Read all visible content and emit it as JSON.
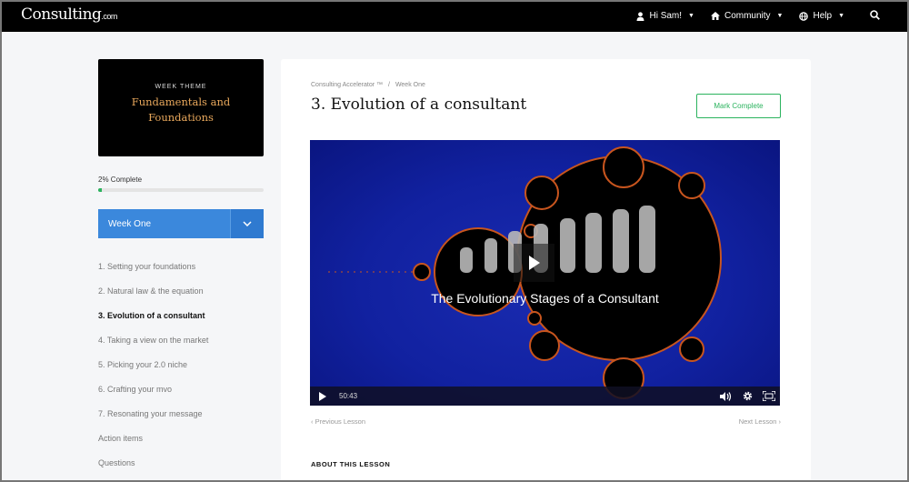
{
  "brand": {
    "logo_main": "Consulting",
    "logo_sub": ".com"
  },
  "nav": {
    "greeting": "Hi Sam!",
    "community": "Community",
    "help": "Help",
    "icons": [
      "user-icon",
      "home-icon",
      "globe-icon",
      "search-icon"
    ]
  },
  "sidebar": {
    "theme_kicker": "WEEK THEME",
    "theme_title": "Fundamentals and Foundations",
    "progress_label": "2% Complete",
    "progress_fraction": 0.02,
    "week_label": "Week One",
    "lessons": [
      "1. Setting your foundations",
      "2. Natural law & the equation",
      "3. Evolution of a consultant",
      "4. Taking a view on the market",
      "5. Picking your 2.0 niche",
      "6. Crafting your mvo",
      "7. Resonating your message",
      "Action items",
      "Questions"
    ],
    "active_lesson_index": 2
  },
  "main": {
    "breadcrumb": [
      "Consulting Accelerator ™",
      "Week One"
    ],
    "title": "3. Evolution of a consultant",
    "mark_complete": "Mark Complete",
    "video": {
      "caption": "The Evolutionary Stages of a Consultant",
      "time": "50:43"
    },
    "prev": "‹ Previous Lesson",
    "next": "Next Lesson ›",
    "about": "ABOUT THIS LESSON"
  },
  "colors": {
    "accent_green": "#2bb35e",
    "accent_blue": "#3b88dc",
    "theme_gold": "#e9a85c"
  }
}
